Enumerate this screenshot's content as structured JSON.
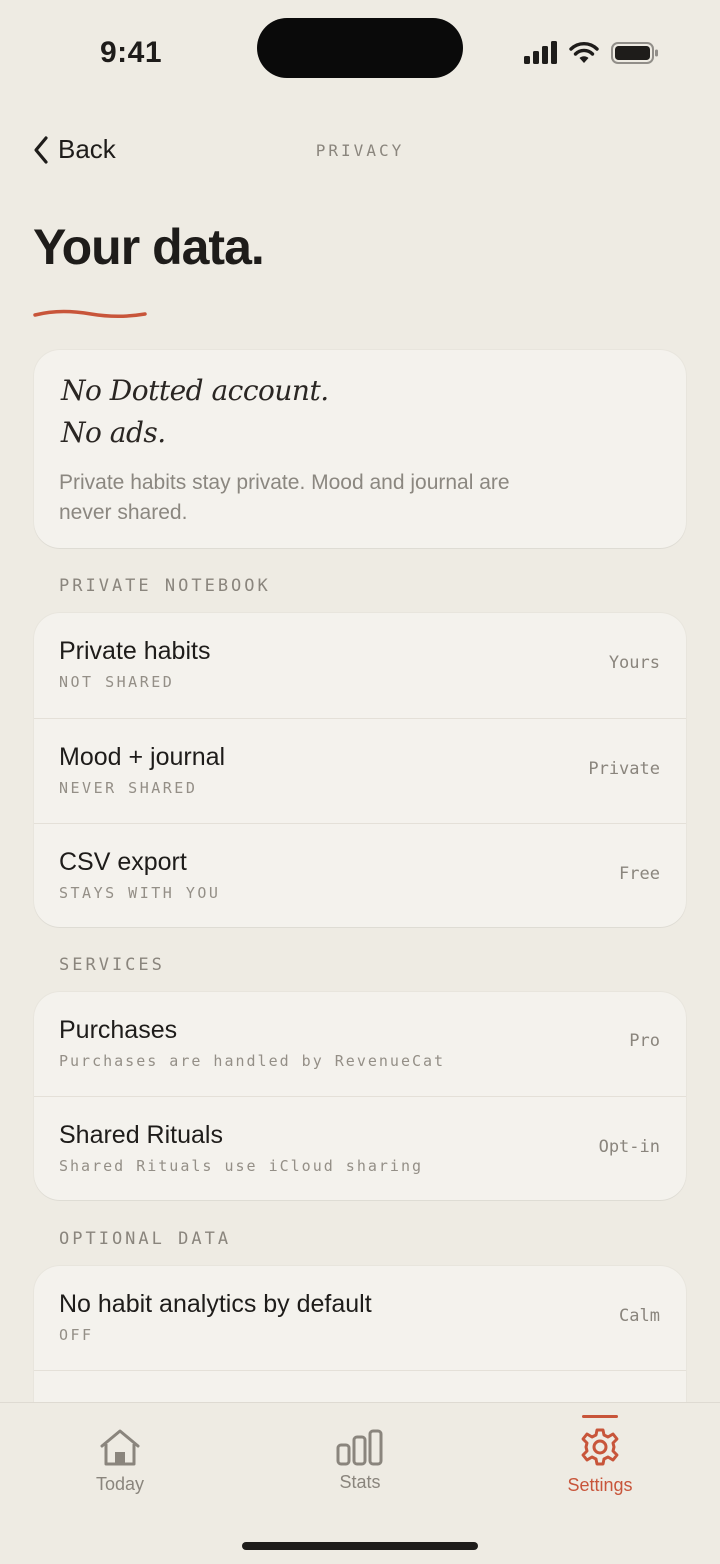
{
  "status": {
    "time": "9:41"
  },
  "nav": {
    "back_label": "Back",
    "title": "PRIVACY"
  },
  "page": {
    "title": "Your data."
  },
  "intro": {
    "line1": "No Dotted account.",
    "line2": "No ads.",
    "body": "Private habits stay private. Mood and journal are never shared."
  },
  "sections": {
    "private_notebook": {
      "label": "PRIVATE NOTEBOOK",
      "rows": [
        {
          "title": "Private habits",
          "sub": "NOT SHARED",
          "value": "Yours"
        },
        {
          "title": "Mood + journal",
          "sub": "NEVER SHARED",
          "value": "Private"
        },
        {
          "title": "CSV export",
          "sub": "STAYS WITH YOU",
          "value": "Free"
        }
      ]
    },
    "services": {
      "label": "SERVICES",
      "rows": [
        {
          "title": "Purchases",
          "sub": "Purchases are handled by RevenueCat",
          "value": "Pro"
        },
        {
          "title": "Shared Rituals",
          "sub": "Shared Rituals use iCloud sharing",
          "value": "Opt-in"
        }
      ]
    },
    "optional_data": {
      "label": "OPTIONAL DATA",
      "rows": [
        {
          "title": "No habit analytics by default",
          "sub": "OFF",
          "value": "Calm"
        }
      ]
    }
  },
  "tabs": [
    {
      "label": "Today",
      "icon": "home-icon"
    },
    {
      "label": "Stats",
      "icon": "stats-icon"
    },
    {
      "label": "Settings",
      "icon": "gear-icon",
      "active": true
    }
  ],
  "colors": {
    "accent": "#c8553a",
    "background": "#eeebe3",
    "card": "#f4f2ed"
  }
}
